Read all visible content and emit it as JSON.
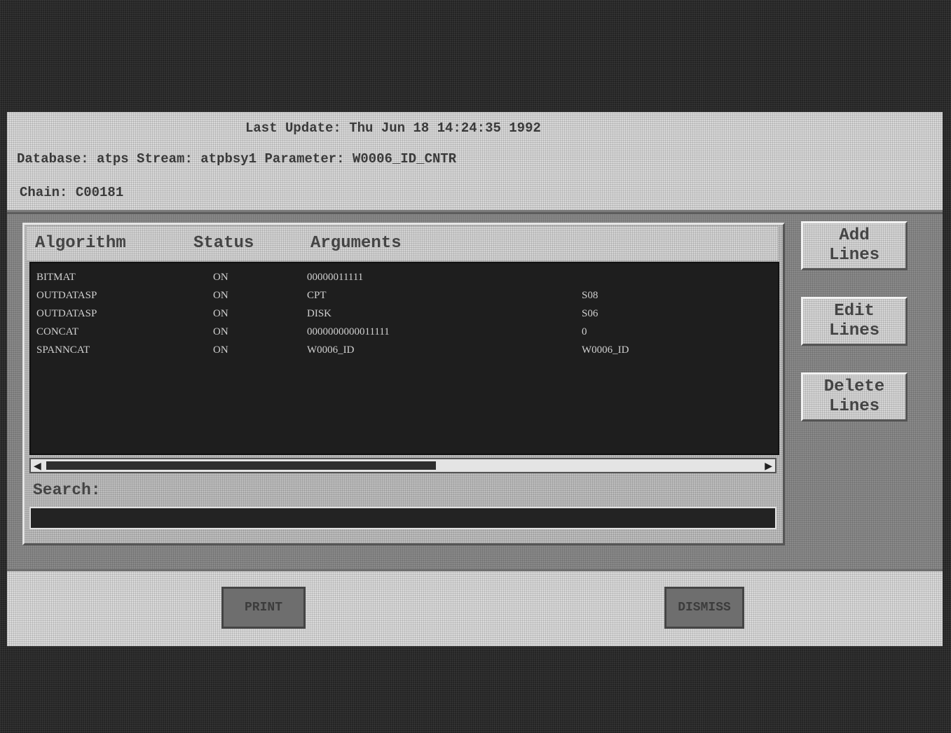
{
  "header": {
    "last_update_label": "Last Update:",
    "last_update_value": "Thu Jun 18 14:24:35 1992",
    "database_label": "Database:",
    "database_value": "atps",
    "stream_label": "Stream:",
    "stream_value": "atpbsy1",
    "parameter_label": "Parameter:",
    "parameter_value": "W0006_ID_CNTR",
    "chain_label": "Chain:",
    "chain_value": "C00181"
  },
  "list": {
    "columns": {
      "algorithm": "Algorithm",
      "status": "Status",
      "arguments": "Arguments"
    },
    "rows": [
      {
        "algorithm": "BITMAT",
        "status": "ON",
        "arg1": "00000011111",
        "arg2": ""
      },
      {
        "algorithm": "OUTDATASP",
        "status": "ON",
        "arg1": "CPT",
        "arg2": "S08"
      },
      {
        "algorithm": "OUTDATASP",
        "status": "ON",
        "arg1": "DISK",
        "arg2": "S06"
      },
      {
        "algorithm": "CONCAT",
        "status": "ON",
        "arg1": "0000000000011111",
        "arg2": "0"
      },
      {
        "algorithm": "SPANNCAT",
        "status": "ON",
        "arg1": "W0006_ID",
        "arg2": "W0006_ID"
      }
    ],
    "scrollbar_left_icon": "arrow-left",
    "scrollbar_right_icon": "arrow-right"
  },
  "search": {
    "label": "Search:",
    "value": ""
  },
  "buttons": {
    "add": {
      "line1": "Add",
      "line2": "Lines"
    },
    "edit": {
      "line1": "Edit",
      "line2": "Lines"
    },
    "delete": {
      "line1": "Delete",
      "line2": "Lines"
    },
    "print": "PRINT",
    "dismiss": "DISMISS"
  }
}
